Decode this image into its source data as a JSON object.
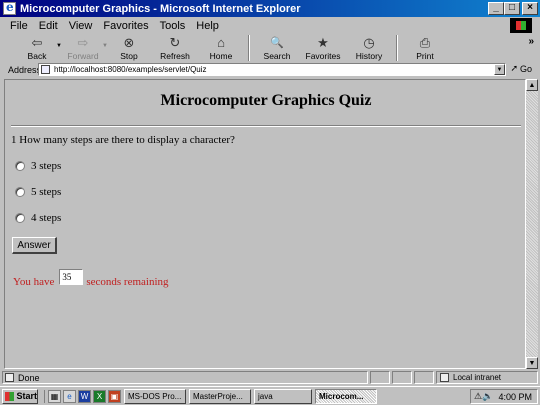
{
  "window": {
    "title": "Microcomputer Graphics - Microsoft Internet Explorer",
    "buttons": [
      "_",
      "□",
      "×"
    ]
  },
  "menu": [
    "File",
    "Edit",
    "View",
    "Favorites",
    "Tools",
    "Help"
  ],
  "toolbar": [
    {
      "label": "Back",
      "icon": "back-arrow-icon",
      "glyph": "⇦",
      "enabled": true
    },
    {
      "label": "Forward",
      "icon": "forward-arrow-icon",
      "glyph": "⇨",
      "enabled": false
    },
    {
      "label": "Stop",
      "icon": "stop-icon",
      "glyph": "⊗",
      "enabled": true
    },
    {
      "label": "Refresh",
      "icon": "refresh-icon",
      "glyph": "↻",
      "enabled": true
    },
    {
      "label": "Home",
      "icon": "home-icon",
      "glyph": "⌂",
      "enabled": true
    },
    {
      "label": "Search",
      "icon": "search-icon",
      "glyph": "🔍",
      "enabled": true
    },
    {
      "label": "Favorites",
      "icon": "favorites-icon",
      "glyph": "★",
      "enabled": true
    },
    {
      "label": "History",
      "icon": "history-icon",
      "glyph": "◷",
      "enabled": true
    },
    {
      "label": "Print",
      "icon": "print-icon",
      "glyph": "⎙",
      "enabled": true
    }
  ],
  "address": {
    "label": "Address",
    "url": "http://localhost:8080/examples/servlet/Quiz",
    "go_label": "Go"
  },
  "page": {
    "title": "Microcomputer Graphics Quiz",
    "question": "1 How many steps are there to display a character?",
    "options": [
      "3 steps",
      "5 steps",
      "4 steps"
    ],
    "answer_button": "Answer",
    "timer_prefix": "You have",
    "timer_value": "35",
    "timer_suffix": "seconds remaining"
  },
  "status": {
    "text": "Done",
    "zone": "Local intranet"
  },
  "taskbar": {
    "start": "Start",
    "quicklaunch": [
      "Desktop",
      "IE",
      "Word",
      "Excel",
      "Other"
    ],
    "tasks": [
      "MS-DOS Pro...",
      "MasterProje...",
      "java",
      "Microcom..."
    ],
    "active_task": 3,
    "clock": "4:00 PM"
  },
  "colors": {
    "timer_text": "#c02020",
    "title_gradient_start": "#000080",
    "title_gradient_end": "#1084d0"
  }
}
